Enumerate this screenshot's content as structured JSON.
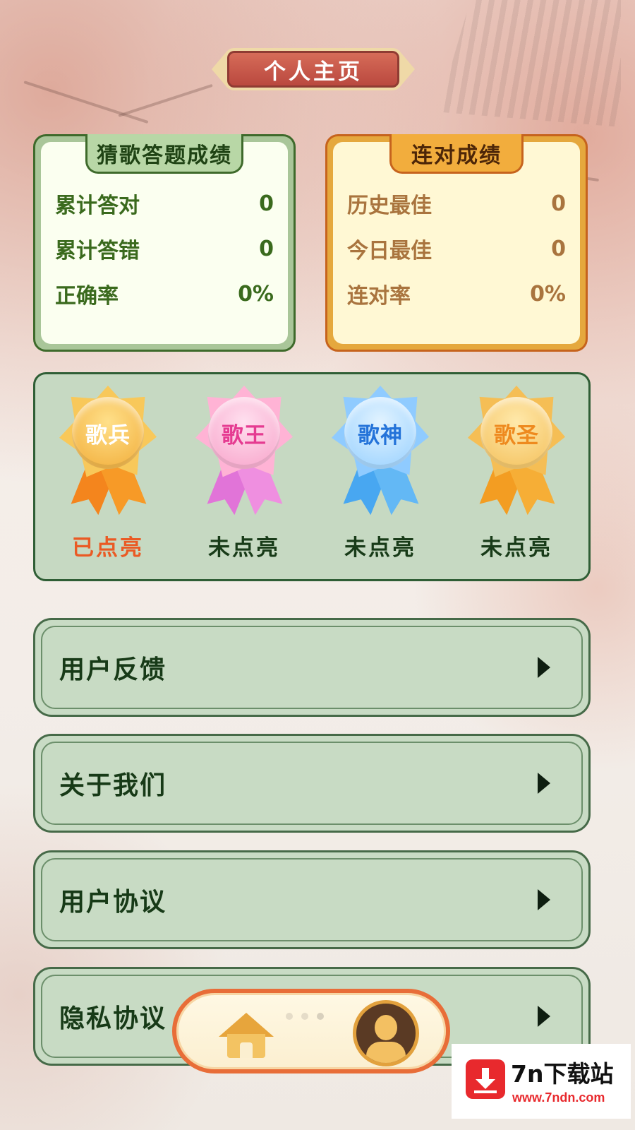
{
  "page": {
    "title": "个人主页"
  },
  "quiz_card": {
    "title": "猜歌答题成绩",
    "rows": [
      {
        "label": "累计答对",
        "value": "0"
      },
      {
        "label": "累计答错",
        "value": "0"
      },
      {
        "label": "正确率",
        "value": "0%"
      }
    ]
  },
  "streak_card": {
    "title": "连对成绩",
    "rows": [
      {
        "label": "历史最佳",
        "value": "0"
      },
      {
        "label": "今日最佳",
        "value": "0"
      },
      {
        "label": "连对率",
        "value": "0%"
      }
    ]
  },
  "medals": [
    {
      "name": "歌兵",
      "status": "已点亮",
      "status_color": "#ea5a24",
      "theme": "gold"
    },
    {
      "name": "歌王",
      "status": "未点亮",
      "status_color": "#183b18",
      "theme": "pink"
    },
    {
      "name": "歌神",
      "status": "未点亮",
      "status_color": "#183b18",
      "theme": "blue"
    },
    {
      "name": "歌圣",
      "status": "未点亮",
      "status_color": "#183b18",
      "theme": "orange"
    }
  ],
  "menu": [
    {
      "label": "用户反馈"
    },
    {
      "label": "关于我们"
    },
    {
      "label": "用户协议"
    },
    {
      "label": "隐私协议"
    }
  ],
  "bottom_nav": {
    "home_icon": "home-icon",
    "profile_icon": "profile-icon"
  },
  "watermark": {
    "title": "7n下载站",
    "url": "www.7ndn.com"
  }
}
